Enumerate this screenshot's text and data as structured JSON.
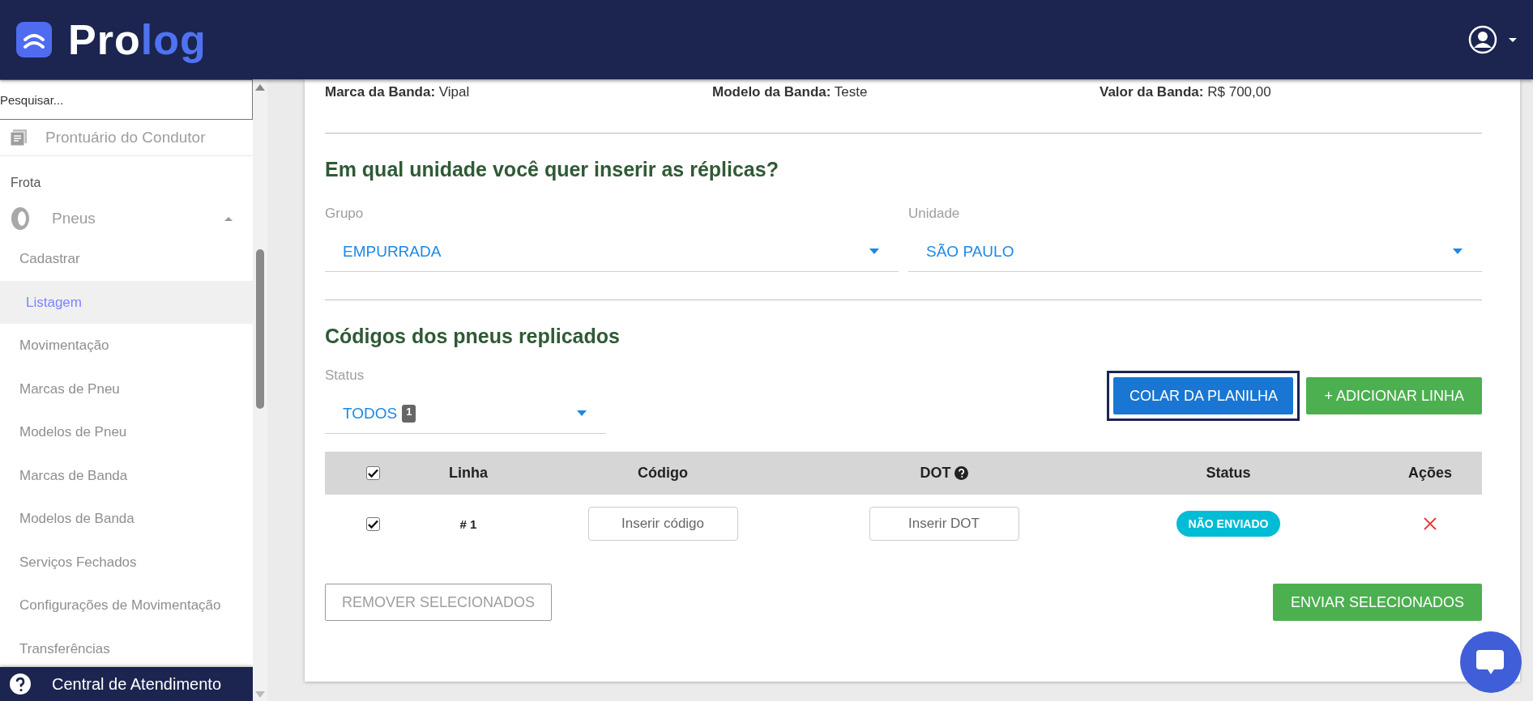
{
  "header": {
    "logo_part1": "Pro",
    "logo_part2": "log"
  },
  "sidebar": {
    "search": {
      "placeholder": "Pesquisar..."
    },
    "top_item": "Prontuário do Condutor",
    "section": "Frota",
    "group": {
      "label": "Pneus",
      "expanded": true,
      "children": [
        {
          "label": "Cadastrar",
          "selected": false
        },
        {
          "label": "Listagem",
          "selected": true
        },
        {
          "label": "Movimentação",
          "selected": false
        },
        {
          "label": "Marcas de Pneu",
          "selected": false
        },
        {
          "label": "Modelos de Pneu",
          "selected": false
        },
        {
          "label": "Marcas de Banda",
          "selected": false
        },
        {
          "label": "Modelos de Banda",
          "selected": false
        },
        {
          "label": "Serviços Fechados",
          "selected": false
        },
        {
          "label": "Configurações de Movimentação",
          "selected": false
        },
        {
          "label": "Transferências",
          "selected": false
        }
      ]
    },
    "help": "Central de Atendimento"
  },
  "info": [
    {
      "label": "Marca da Banda:",
      "value": "Vipal"
    },
    {
      "label": "Modelo da Banda:",
      "value": "Teste"
    },
    {
      "label": "Valor da Banda:",
      "value": "R$ 700,00"
    }
  ],
  "unit_section": {
    "title": "Em qual unidade você quer inserir as réplicas?",
    "fields": [
      {
        "label": "Grupo",
        "value": "EMPURRADA"
      },
      {
        "label": "Unidade",
        "value": "SÃO PAULO"
      }
    ]
  },
  "codes_section": {
    "title": "Códigos dos pneus replicados",
    "status_filter": {
      "label": "Status",
      "value": "TODOS",
      "count": "1"
    },
    "buttons": [
      {
        "label": "COLAR DA PLANILHA",
        "kind": "primary",
        "focused": true
      },
      {
        "label": "+ ADICIONAR LINHA",
        "kind": "success",
        "focused": false
      }
    ],
    "table": {
      "select_all_checked": true,
      "columns": [
        {
          "label": "Linha",
          "hint": false
        },
        {
          "label": "Código",
          "hint": false
        },
        {
          "label": "DOT",
          "hint": true
        },
        {
          "label": "Status",
          "hint": false
        },
        {
          "label": "Ações",
          "hint": false
        }
      ],
      "rows": [
        {
          "checked": true,
          "line": "# 1",
          "code_placeholder": "Inserir código",
          "dot_placeholder": "Inserir DOT",
          "status": {
            "label": "NÃO ENVIADO",
            "color": "#00bcd4"
          }
        }
      ]
    },
    "footer_buttons": [
      {
        "label": "REMOVER SELECIONADOS",
        "kind": "outline"
      },
      {
        "label": "ENVIAR SELECIONADOS",
        "kind": "success"
      }
    ]
  }
}
